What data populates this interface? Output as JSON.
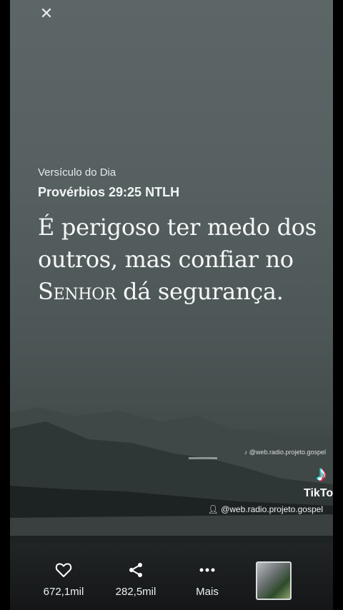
{
  "overlay": {
    "close_icon": "close-icon"
  },
  "verse": {
    "overline": "Versículo do Dia",
    "reference": "Provérbios 29:25 NTLH",
    "text_part1": "É perigoso ter medo dos outros, mas confiar no ",
    "text_lord": "Senhor",
    "text_part2": " dá segurança."
  },
  "watermark": {
    "handle_small": "@web.radio.projeto.gospel",
    "brand": "TikTok",
    "handle_main": "@web.radio.projeto.gospel"
  },
  "actions": {
    "like_count": "672,1mil",
    "share_count": "282,5mil",
    "more_label": "Mais"
  },
  "colors": {
    "tiktok_cyan": "#25f4ee",
    "tiktok_red": "#fe2c55"
  }
}
